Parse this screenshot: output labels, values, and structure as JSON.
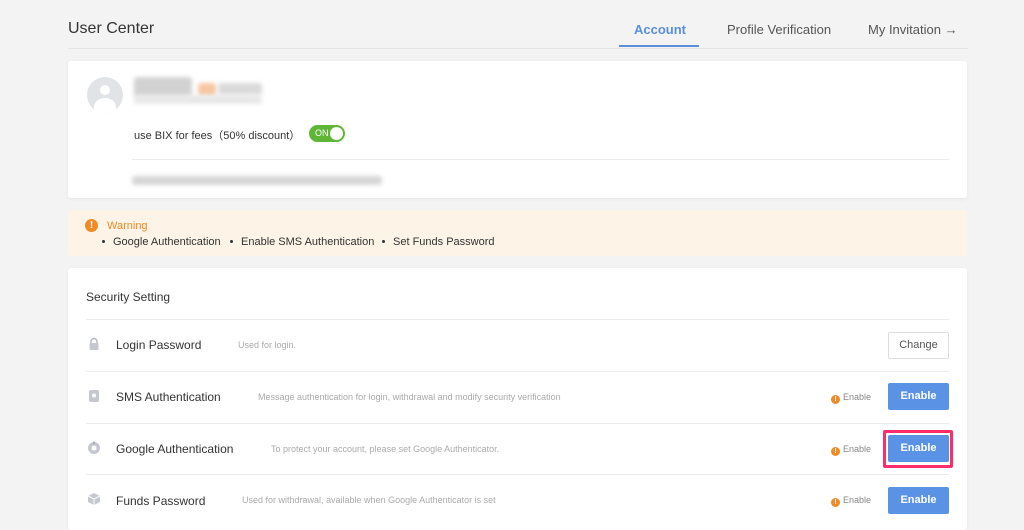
{
  "header": {
    "title": "User Center",
    "tabs": [
      {
        "label": "Account",
        "active": true
      },
      {
        "label": "Profile Verification",
        "active": false
      },
      {
        "label": "My Invitation →",
        "active": false
      }
    ]
  },
  "profile": {
    "fee_label": "use BIX for fees（50% discount）",
    "fee_toggle": {
      "label": "ON",
      "state": "on"
    }
  },
  "warning": {
    "title": "Warning",
    "items": [
      "Google Authentication",
      "Enable SMS Authentication",
      "Set Funds Password"
    ]
  },
  "security": {
    "title": "Security Setting",
    "rows": [
      {
        "label": "Login Password",
        "desc": "Used for login.",
        "status": "",
        "button": "Change"
      },
      {
        "label": "SMS Authentication",
        "desc": "Message authentication for login, withdrawal and modify security verification",
        "status": "Enable",
        "button": "Enable"
      },
      {
        "label": "Google Authentication",
        "desc": "To protect your account, please set Google Authenticator.",
        "status": "Enable",
        "button": "Enable"
      },
      {
        "label": "Funds Password",
        "desc": "Used for withdrawal, available when Google Authenticator is set",
        "status": "Enable",
        "button": "Enable"
      }
    ]
  },
  "colors": {
    "accent": "#5b8fd8",
    "button_primary": "#5a93e6",
    "toggle_on": "#5fb536",
    "warning": "#f08a24",
    "warning_bg": "#fdf3e6",
    "highlight": "#ff2d6b"
  }
}
